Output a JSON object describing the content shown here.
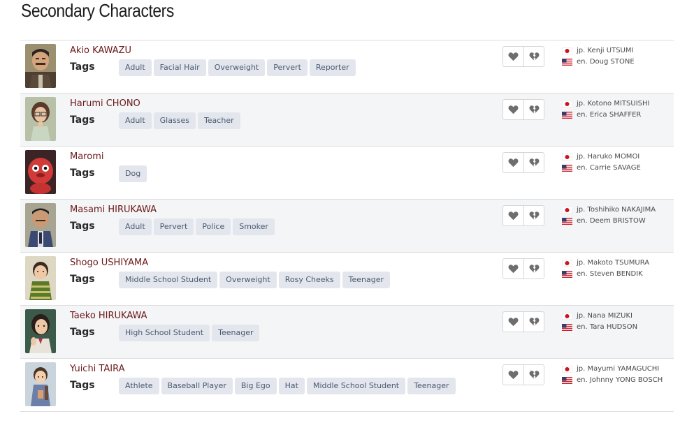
{
  "section": {
    "title": "Secondary Characters"
  },
  "characters": [
    {
      "name": "Akio KAWAZU",
      "tags_label": "Tags",
      "tags": [
        "Adult",
        "Facial Hair",
        "Overweight",
        "Pervert",
        "Reporter"
      ],
      "va_jp": "jp. Kenji UTSUMI",
      "va_en": "en. Doug STONE"
    },
    {
      "name": "Harumi CHONO",
      "tags_label": "Tags",
      "tags": [
        "Adult",
        "Glasses",
        "Teacher"
      ],
      "va_jp": "jp. Kotono MITSUISHI",
      "va_en": "en. Erica SHAFFER"
    },
    {
      "name": "Maromi",
      "tags_label": "Tags",
      "tags": [
        "Dog"
      ],
      "va_jp": "jp. Haruko MOMOI",
      "va_en": "en. Carrie SAVAGE"
    },
    {
      "name": "Masami HIRUKAWA",
      "tags_label": "Tags",
      "tags": [
        "Adult",
        "Pervert",
        "Police",
        "Smoker"
      ],
      "va_jp": "jp. Toshihiko NAKAJIMA",
      "va_en": "en. Deem BRISTOW"
    },
    {
      "name": "Shogo USHIYAMA",
      "tags_label": "Tags",
      "tags": [
        "Middle School Student",
        "Overweight",
        "Rosy Cheeks",
        "Teenager"
      ],
      "va_jp": "jp. Makoto TSUMURA",
      "va_en": "en. Steven BENDIK"
    },
    {
      "name": "Taeko HIRUKAWA",
      "tags_label": "Tags",
      "tags": [
        "High School Student",
        "Teenager"
      ],
      "va_jp": "jp. Nana MIZUKI",
      "va_en": "en. Tara HUDSON"
    },
    {
      "name": "Yuichi TAIRA",
      "tags_label": "Tags",
      "tags": [
        "Athlete",
        "Baseball Player",
        "Big Ego",
        "Hat",
        "Middle School Student",
        "Teenager"
      ],
      "va_jp": "jp. Mayumi YAMAGUCHI",
      "va_en": "en. Johnny YONG BOSCH"
    }
  ],
  "icons": {
    "love": "heart-icon",
    "hate": "broken-heart-icon",
    "flag_jp": "japan-flag-icon",
    "flag_us": "us-flag-icon"
  },
  "colors": {
    "name": "#6b1818",
    "tag_bg": "#e3e6ec",
    "tag_text": "#4a5a72",
    "row_alt": "#f4f5f7"
  }
}
